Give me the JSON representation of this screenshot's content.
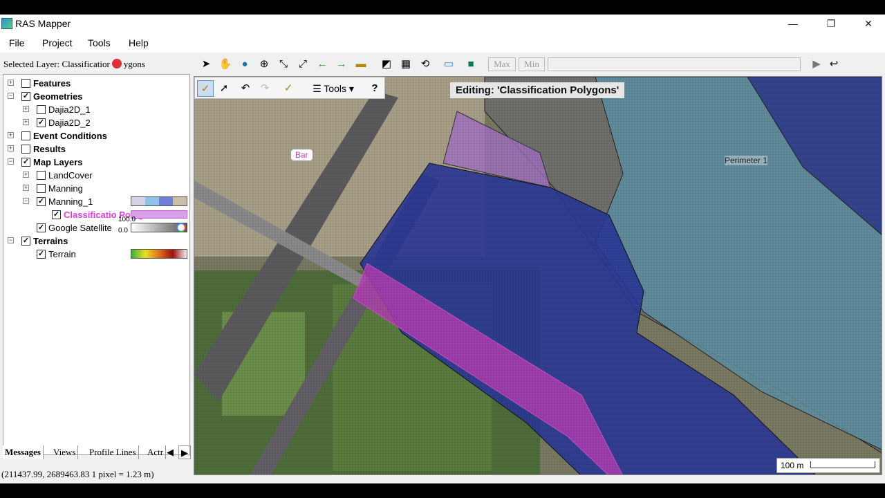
{
  "window": {
    "title": "RAS Mapper",
    "minimize": "—",
    "restore": "❐",
    "close": "✕"
  },
  "menu": [
    "File",
    "Project",
    "Tools",
    "Help"
  ],
  "selected_layer": {
    "prefix": "Selected Layer: Classificatior",
    "suffix": "ygons"
  },
  "tree": {
    "features": "Features",
    "geometries": "Geometries",
    "dajia1": "Dajia2D_1",
    "dajia2": "Dajia2D_2",
    "event": "Event Conditions",
    "results": "Results",
    "map_layers": "Map Layers",
    "landcover": "LandCover",
    "manning": "Manning",
    "manning1": "Manning_1",
    "class_poly": "Classificatio Polygons",
    "google": "Google Satellite",
    "google_range": [
      "100.0",
      "0.0"
    ],
    "terrains": "Terrains",
    "terrain": "Terrain"
  },
  "tabs": [
    "Messages",
    "Views",
    "Profile Lines",
    "Actr"
  ],
  "tab_arrows": [
    "◀",
    "▶"
  ],
  "status": "(211437.99, 2689463.83  1 pixel = 1.23 m)",
  "toolbar": {
    "max": "Max",
    "min": "Min"
  },
  "edit_toolbar": {
    "tools": "Tools",
    "help": "?"
  },
  "map": {
    "editing": "Editing: 'Classification Polygons'",
    "bar_label": "Bar",
    "perimeter": "Perimeter 1",
    "scale": "100 m"
  },
  "colors": {
    "accent": "#1e6fd9",
    "highlight": "#e040e0",
    "selected_dot": "#e0303a"
  },
  "icons": {
    "expand_plus": "⊞",
    "expand_minus": "⊟",
    "check": "✓"
  }
}
